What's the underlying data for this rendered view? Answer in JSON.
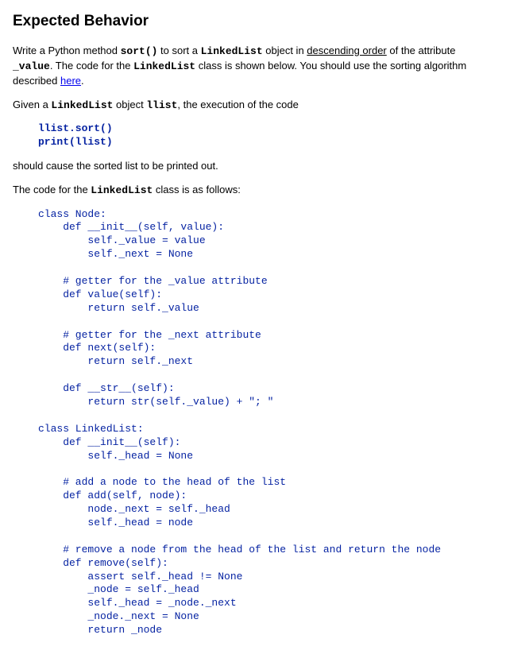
{
  "heading": "Expected Behavior",
  "p1_a": "Write a Python method ",
  "p1_sort": "sort()",
  "p1_b": " to sort a ",
  "p1_ll": "LinkedList",
  "p1_c": " object in ",
  "p1_desc": "descending order",
  "p1_d": " of the attribute ",
  "p1_val": "_value",
  "p1_e": ". The code for the ",
  "p1_ll2": "LinkedList",
  "p1_f": " class is shown below. You should use the sorting algorithm described ",
  "p1_here": "here",
  "p1_g": ".",
  "p2_a": "Given a ",
  "p2_ll": "LinkedList",
  "p2_b": " object ",
  "p2_llist": "llist",
  "p2_c": ", the execution of the code",
  "code1_l1": "llist.sort()",
  "code1_l2": "print(llist)",
  "p3": "should cause the sorted list to be printed out.",
  "p4_a": "The code for the ",
  "p4_ll": "LinkedList",
  "p4_b": " class is as follows:",
  "code2": "class Node:\n    def __init__(self, value):\n        self._value = value\n        self._next = None\n\n    # getter for the _value attribute\n    def value(self):\n        return self._value\n\n    # getter for the _next attribute\n    def next(self):\n        return self._next\n\n    def __str__(self):\n        return str(self._value) + \"; \"\n\nclass LinkedList:\n    def __init__(self):\n        self._head = None\n\n    # add a node to the head of the list\n    def add(self, node):\n        node._next = self._head\n        self._head = node\n\n    # remove a node from the head of the list and return the node\n    def remove(self):\n        assert self._head != None\n        _node = self._head\n        self._head = _node._next\n        _node._next = None\n        return _node"
}
